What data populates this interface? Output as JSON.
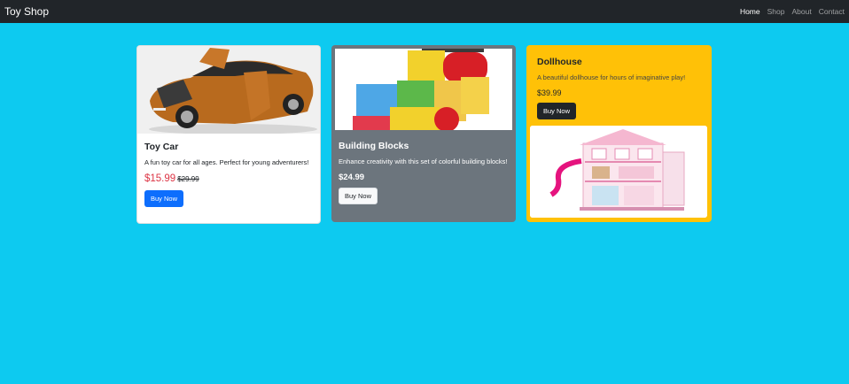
{
  "navbar": {
    "brand": "Toy Shop",
    "links": [
      {
        "label": "Home",
        "active": true
      },
      {
        "label": "Shop"
      },
      {
        "label": "About"
      },
      {
        "label": "Contact"
      }
    ]
  },
  "products": [
    {
      "title": "Toy Car",
      "description": "A fun toy car for all ages. Perfect for young adventurers!",
      "price": "$15.99",
      "old_price": "$29.99",
      "button": "Buy Now",
      "image": "orange-sports-car-photo"
    },
    {
      "title": "Building Blocks",
      "description": "Enhance creativity with this set of colorful building blocks!",
      "price": "$24.99",
      "button": "Buy Now",
      "image": "colorful-wooden-blocks-photo"
    },
    {
      "title": "Dollhouse",
      "description": "A beautiful dollhouse for hours of imaginative play!",
      "price": "$39.99",
      "button": "Buy Now",
      "image": "pink-dollhouse-photo"
    }
  ],
  "colors": {
    "page_background": "#0dcaf0",
    "navbar": "#212529",
    "primary": "#0d6efd",
    "secondary": "#6c757d",
    "warning": "#ffc107",
    "sale_price": "#dc3545"
  }
}
